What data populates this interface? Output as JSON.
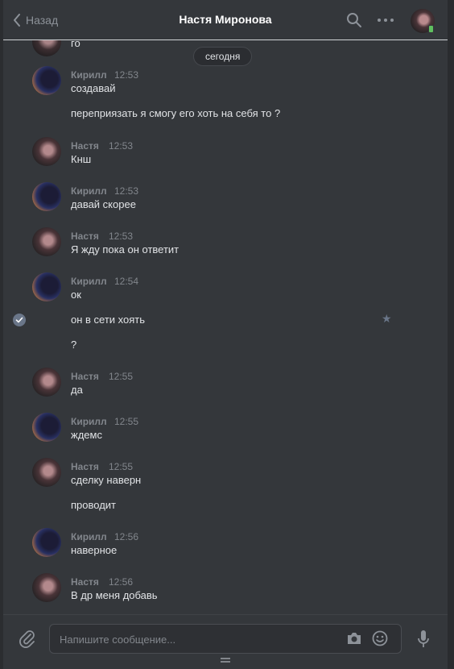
{
  "header": {
    "back_label": "Назад",
    "title": "Настя Миронова"
  },
  "date_divider": "сегодня",
  "partial_message": "го",
  "messages": [
    {
      "author": "Кирилл",
      "time": "12:53",
      "lines": [
        "создавай",
        "переприязать я смогу его хоть на себя то ?"
      ]
    },
    {
      "author": "Настя",
      "time": "12:53",
      "lines": [
        "Кнш"
      ]
    },
    {
      "author": "Кирилл",
      "time": "12:53",
      "lines": [
        "давай скорее"
      ]
    },
    {
      "author": "Настя",
      "time": "12:53",
      "lines": [
        "Я жду пока он ответит"
      ]
    },
    {
      "author": "Кирилл",
      "time": "12:54",
      "lines": [
        "ок",
        "он в сети хоять",
        "?"
      ]
    },
    {
      "author": "Настя",
      "time": "12:55",
      "lines": [
        "да"
      ]
    },
    {
      "author": "Кирилл",
      "time": "12:55",
      "lines": [
        "ждемс"
      ]
    },
    {
      "author": "Настя",
      "time": "12:55",
      "lines": [
        "сделку наверн",
        "проводит"
      ]
    },
    {
      "author": "Кирилл",
      "time": "12:56",
      "lines": [
        "наверное"
      ]
    },
    {
      "author": "Настя",
      "time": "12:56",
      "lines": [
        "В др меня добавь"
      ]
    }
  ],
  "composer": {
    "placeholder": "Напишите сообщение..."
  },
  "icons": {
    "back": "chevron-left-icon",
    "search": "search-icon",
    "more": "more-icon",
    "attach": "paperclip-icon",
    "camera": "camera-icon",
    "emoji": "smile-icon",
    "mic": "microphone-icon",
    "selected": "check-icon",
    "favorite": "star-icon"
  },
  "colors": {
    "background": "#34373b",
    "text": "#e1e3e6",
    "muted": "#82868c",
    "online": "#5fc05f"
  }
}
